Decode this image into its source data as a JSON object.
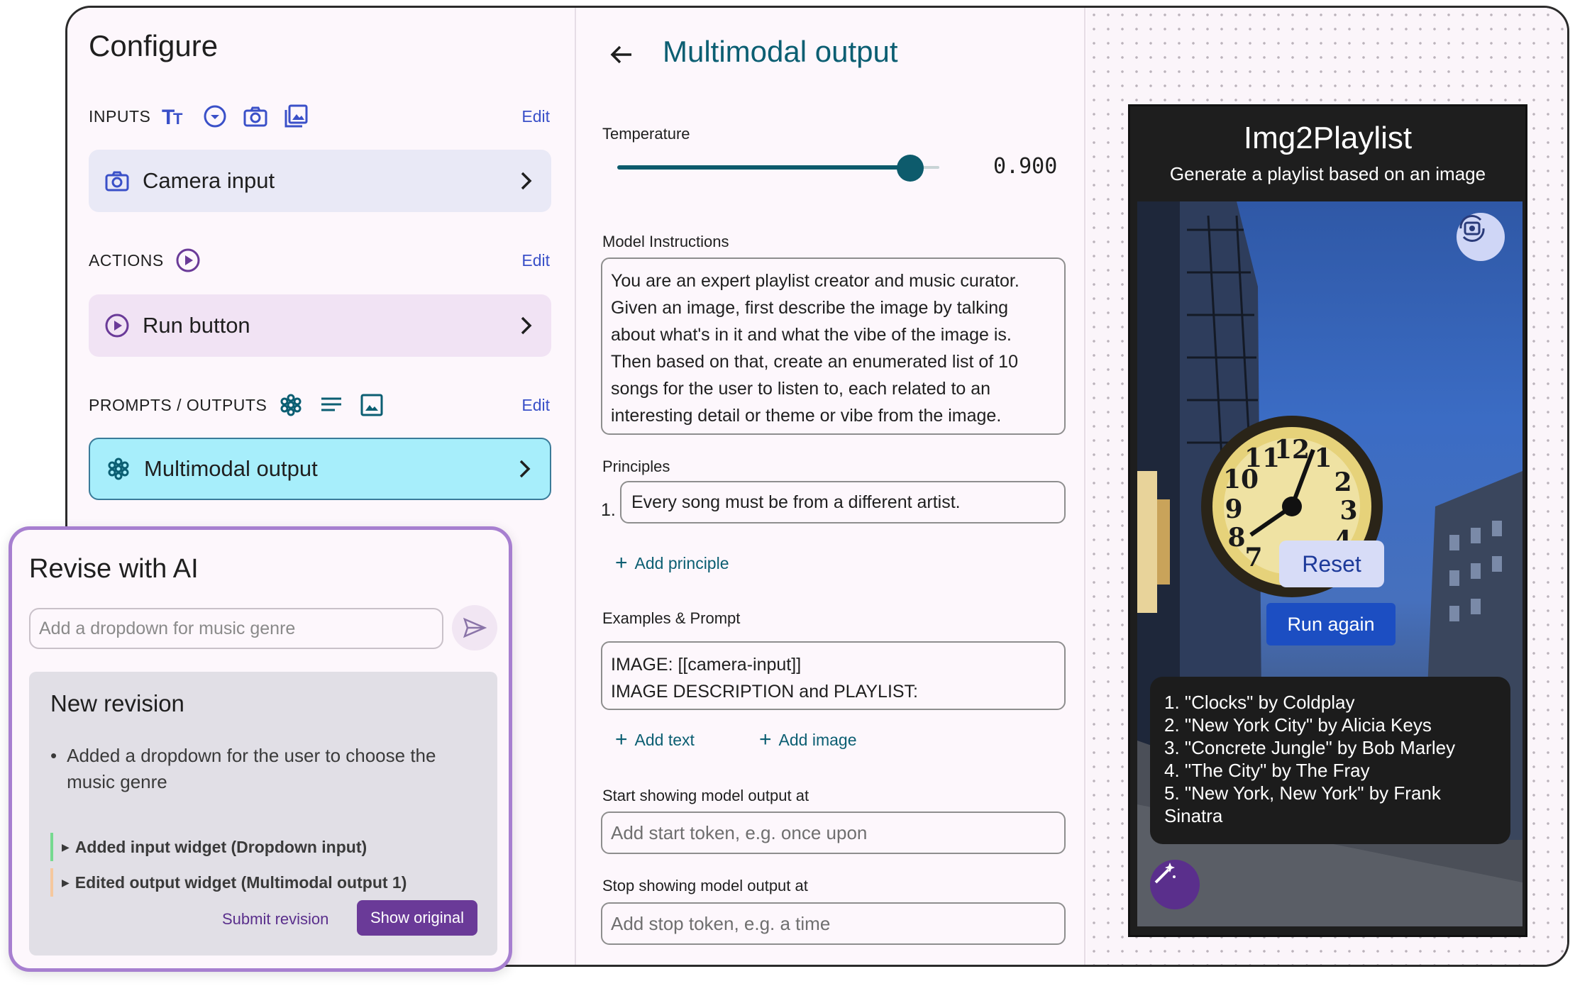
{
  "configure": {
    "title": "Configure",
    "inputs": {
      "label": "INPUTS",
      "edit": "Edit",
      "icons": [
        "text-format-icon",
        "dropdown-circle-icon",
        "camera-icon",
        "image-gallery-icon"
      ]
    },
    "inputs_card": {
      "label": "Camera input",
      "icon": "camera-icon"
    },
    "actions": {
      "label": "ACTIONS",
      "edit": "Edit",
      "icons": [
        "play-circle-icon"
      ]
    },
    "actions_card": {
      "label": "Run button",
      "icon": "play-circle-icon"
    },
    "prompts": {
      "label": "PROMPTS / OUTPUTS",
      "edit": "Edit",
      "icons": [
        "ai-sparkle-icon",
        "text-lines-icon",
        "image-icon"
      ]
    },
    "prompts_card": {
      "label": "Multimodal output",
      "icon": "ai-sparkle-icon"
    }
  },
  "settings": {
    "title": "Multimodal output",
    "temperature": {
      "label": "Temperature",
      "value": "0.900",
      "level": 0.9
    },
    "model_instructions": {
      "label": "Model Instructions",
      "value": "You are an expert playlist creator and music curator.\nGiven an image, first describe the image by talking\nabout what's in it and what the vibe of the image is.\nThen based on that, create an enumerated list of 10\nsongs for the user to listen to, each related to an\ninteresting detail or theme or vibe from the image."
    },
    "principles": {
      "label": "Principles",
      "items": [
        {
          "num": "1.",
          "text": "Every song must be from a different artist."
        }
      ],
      "add_label": "Add principle"
    },
    "examples": {
      "label": "Examples & Prompt",
      "value": "IMAGE: [[camera-input]]\nIMAGE DESCRIPTION and PLAYLIST:",
      "add_text": "Add text",
      "add_image": "Add image"
    },
    "start_output": {
      "label": "Start showing model output at",
      "placeholder": "Add start token, e.g. once upon"
    },
    "stop_output": {
      "label": "Stop showing model output at",
      "placeholder": "Add stop token, e.g. a time"
    }
  },
  "preview": {
    "app_title": "Img2Playlist",
    "app_subtitle": "Generate a playlist based on an image",
    "reset_label": "Reset",
    "run_again_label": "Run again",
    "playlist": [
      "1. \"Clocks\" by Coldplay",
      "2. \"New York City\" by Alicia Keys",
      "3. \"Concrete Jungle\" by Bob Marley",
      "4. \"The City\" by The Fray",
      "5. \"New York, New York\" by Frank",
      "Sinatra"
    ],
    "clock_numerals": [
      "12",
      "1",
      "2",
      "3",
      "4",
      "7",
      "8",
      "9",
      "10",
      "11"
    ]
  },
  "revise": {
    "title": "Revise with AI",
    "input_placeholder": "Add a dropdown for music genre",
    "card_title": "New revision",
    "bullet": "Added a dropdown for the user to choose the music genre",
    "changes": [
      {
        "label": "Added input widget (Dropdown input)",
        "color": "#77d990"
      },
      {
        "label": "Edited output widget (Multimodal output 1)",
        "color": "#f5c89e"
      }
    ],
    "submit_label": "Submit revision",
    "show_original_label": "Show original"
  },
  "colors": {
    "accent_teal": "#0b5e72",
    "active_card": "#a7eefb",
    "revise_border": "#a77fd0",
    "run_button": "#1c4ec2"
  }
}
